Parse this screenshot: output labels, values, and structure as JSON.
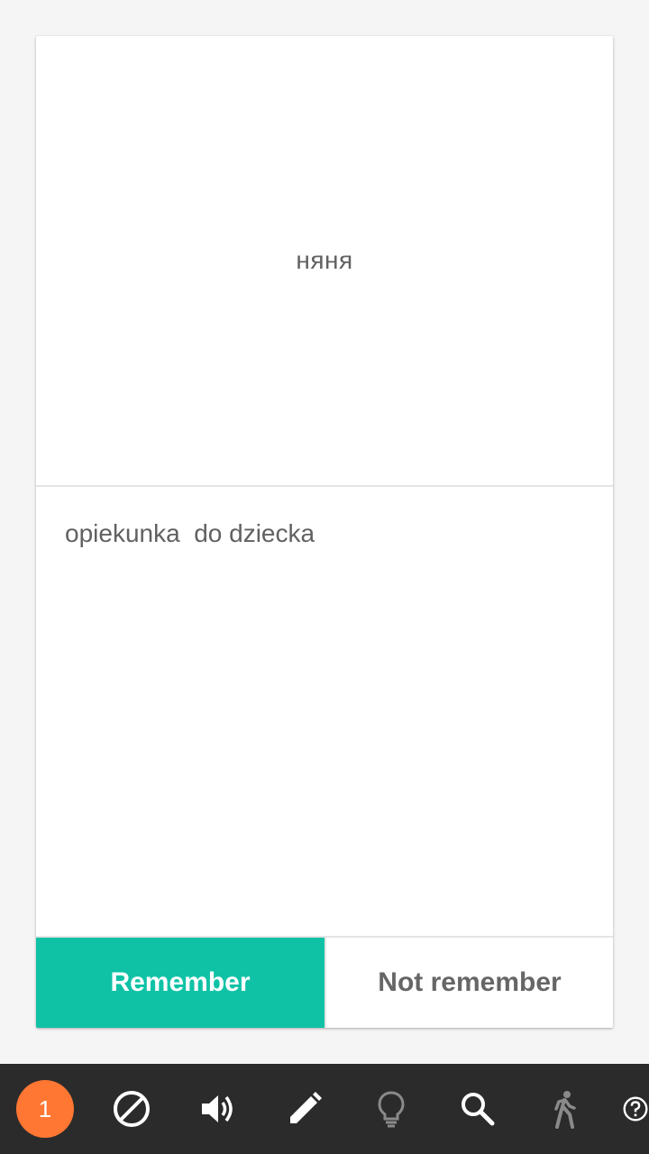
{
  "card": {
    "front_word": "няня",
    "back_text": "opiekunka  do dziecka",
    "remember_label": "Remember",
    "not_remember_label": "Not remember"
  },
  "toolbar": {
    "counter": "1",
    "icons": [
      "block-icon",
      "volume-icon",
      "edit-icon",
      "lightbulb-icon",
      "search-icon",
      "walk-icon",
      "help-icon"
    ]
  },
  "colors": {
    "accent": "#0fc2a6",
    "counter_badge": "#ff7733",
    "toolbar_bg": "#2b2b2b",
    "text_gray": "#616161"
  }
}
